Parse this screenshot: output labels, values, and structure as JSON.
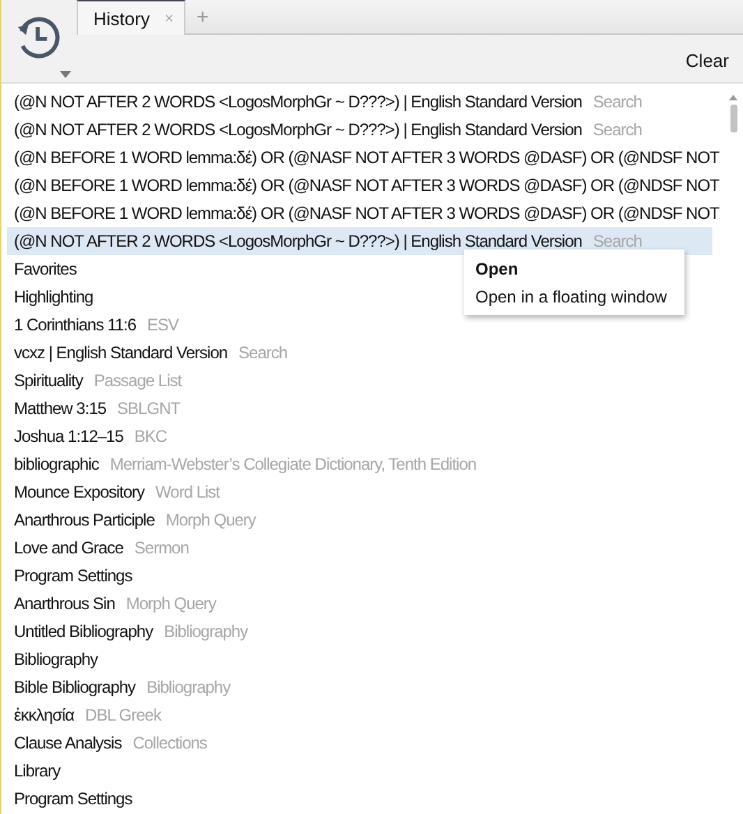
{
  "tabs": [
    {
      "label": "History",
      "selected": true,
      "kind": "document"
    },
    {
      "label": "+",
      "selected": false,
      "kind": "add"
    }
  ],
  "toolbar": {
    "clear_button": "Clear"
  },
  "history": [
    {
      "title": "(@N NOT AFTER 2 WORDS <LogosMorphGr ~ D???>) | English Standard Version",
      "type": "Search",
      "selected": false
    },
    {
      "title": "(@N NOT AFTER 2 WORDS <LogosMorphGr ~ D???>) | English Standard Version",
      "type": "Search",
      "selected": false
    },
    {
      "title": "(@N BEFORE 1 WORD lemma:δέ) OR (@NASF NOT AFTER 3 WORDS @DASF) OR (@NDSF NOT",
      "selected": false
    },
    {
      "title": "(@N BEFORE 1 WORD lemma:δέ) OR (@NASF NOT AFTER 3 WORDS @DASF) OR (@NDSF NOT",
      "selected": false
    },
    {
      "title": "(@N BEFORE 1 WORD lemma:δέ) OR (@NASF NOT AFTER 3 WORDS @DASF) OR (@NDSF NOT",
      "selected": false
    },
    {
      "title": "(@N NOT AFTER 2 WORDS <LogosMorphGr ~ D???>) | English Standard Version",
      "type": "Search",
      "selected": true
    },
    {
      "title": "Favorites",
      "selected": false
    },
    {
      "title": "Highlighting",
      "selected": false
    },
    {
      "title": "1 Corinthians 11:6",
      "type": "ESV",
      "selected": false
    },
    {
      "title": "vcxz | English Standard Version",
      "type": "Search",
      "selected": false
    },
    {
      "title": "Spirituality",
      "type": "Passage List",
      "selected": false
    },
    {
      "title": "Matthew 3:15",
      "type": "SBLGNT",
      "selected": false
    },
    {
      "title": "Joshua 1:12–15",
      "type": "BKC",
      "selected": false
    },
    {
      "title": "bibliographic",
      "type": "Merriam-Webster’s Collegiate Dictionary, Tenth Edition",
      "selected": false
    },
    {
      "title": "Mounce Expository",
      "type": "Word List",
      "selected": false
    },
    {
      "title": "Anarthrous Participle",
      "type": "Morph Query",
      "selected": false
    },
    {
      "title": "Love and Grace",
      "type": "Sermon",
      "selected": false
    },
    {
      "title": "Program Settings",
      "selected": false
    },
    {
      "title": "Anarthrous Sin",
      "type": "Morph Query",
      "selected": false
    },
    {
      "title": "Untitled Bibliography",
      "type": "Bibliography",
      "selected": false
    },
    {
      "title": "Bibliography",
      "selected": false
    },
    {
      "title": "Bible Bibliography",
      "type": "Bibliography",
      "selected": false
    },
    {
      "title": "ἐκκλησία",
      "type": "DBL Greek",
      "selected": false
    },
    {
      "title": "Clause Analysis",
      "type": "Collections",
      "selected": false
    },
    {
      "title": "Library",
      "selected": false
    },
    {
      "title": "Program Settings",
      "selected": false
    }
  ],
  "context_menu": [
    {
      "label": "Open",
      "default": true
    },
    {
      "label": "Open in a floating window",
      "default": false
    }
  ]
}
